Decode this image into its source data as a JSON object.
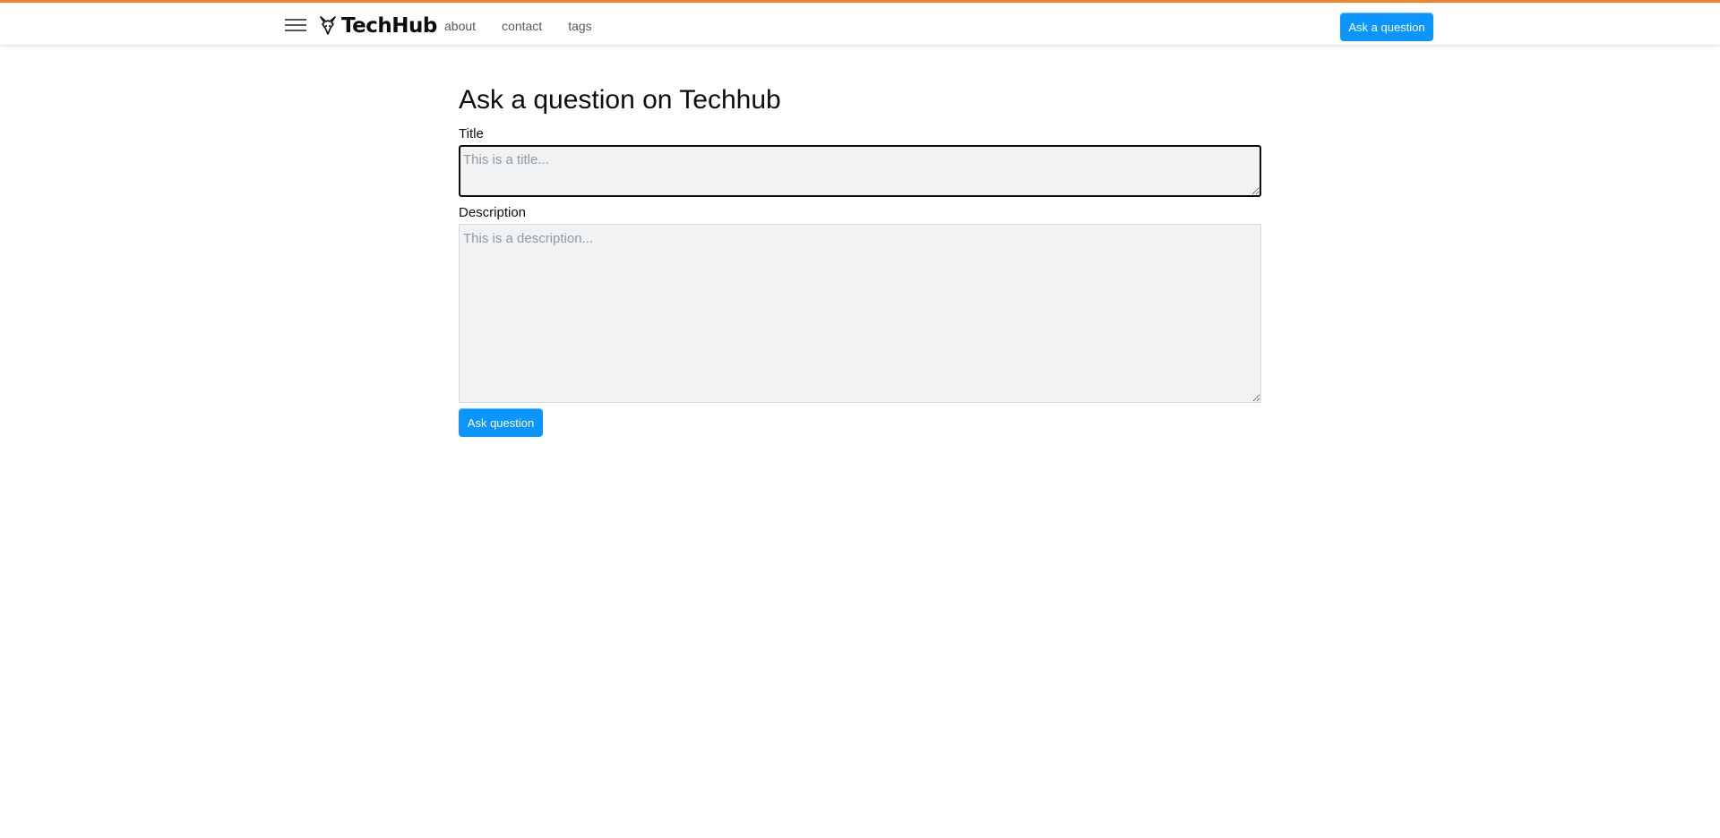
{
  "brand": {
    "name": "TechHub",
    "accent_color": "#f48225",
    "primary_button_color": "#0a95ff"
  },
  "header": {
    "menu_icon": "hamburger-icon",
    "logo_icon": "fox-head-icon",
    "nav": [
      {
        "label": "about"
      },
      {
        "label": "contact"
      },
      {
        "label": "tags"
      }
    ],
    "ask_button_label": "Ask a question"
  },
  "form": {
    "page_title": "Ask a question on Techhub",
    "title_label": "Title",
    "title_placeholder": "This is a title...",
    "title_value": "",
    "description_label": "Description",
    "description_placeholder": "This is a description...",
    "description_value": "",
    "submit_label": "Ask question"
  }
}
